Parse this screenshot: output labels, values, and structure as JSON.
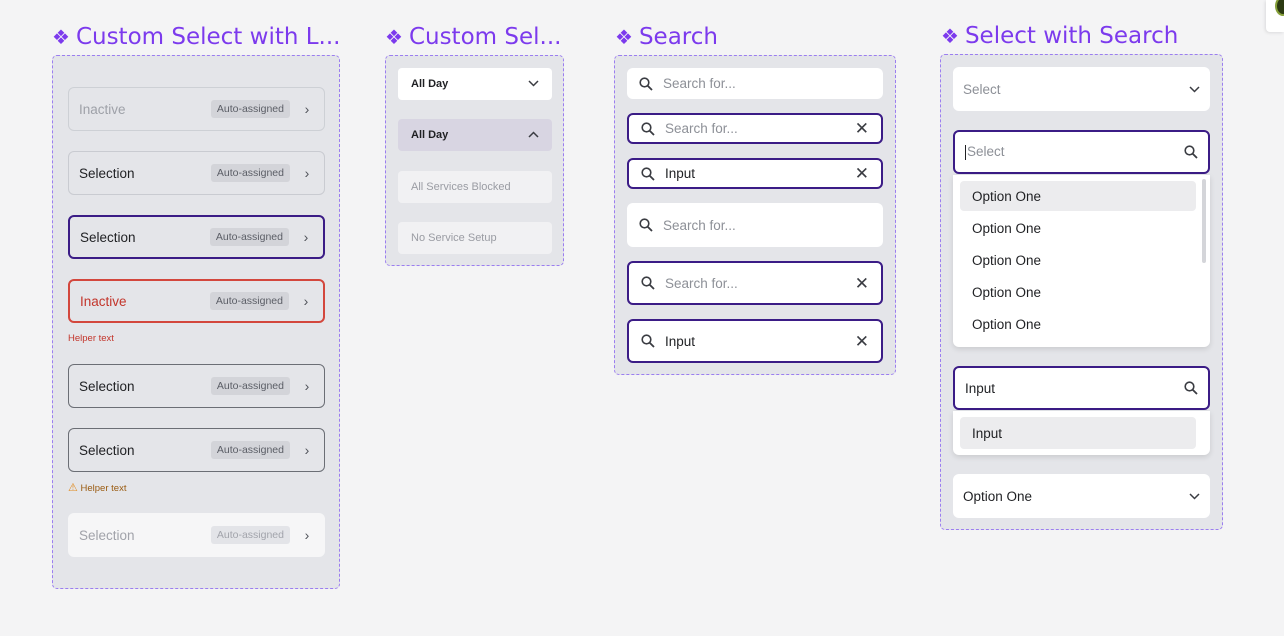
{
  "titles": {
    "custom_select_list": "Custom Select with L...",
    "custom_select": "Custom Sel...",
    "search": "Search",
    "select_with_search": "Select with Search"
  },
  "custom_select_list": {
    "rows": [
      {
        "label": "Inactive",
        "badge": "Auto-assigned",
        "state": "inactive"
      },
      {
        "label": "Selection",
        "badge": "Auto-assigned",
        "state": "default"
      },
      {
        "label": "Selection",
        "badge": "Auto-assigned",
        "state": "active"
      },
      {
        "label": "Inactive",
        "badge": "Auto-assigned",
        "state": "error",
        "helper": "Helper text"
      },
      {
        "label": "Selection",
        "badge": "Auto-assigned",
        "state": "outlined"
      },
      {
        "label": "Selection",
        "badge": "Auto-assigned",
        "state": "warning",
        "helper": "Helper text"
      },
      {
        "label": "Selection",
        "badge": "Auto-assigned",
        "state": "disabled"
      }
    ]
  },
  "custom_select": {
    "items": [
      {
        "label": "All Day",
        "state": "closed"
      },
      {
        "label": "All Day",
        "state": "open"
      },
      {
        "label": "All Services Blocked",
        "state": "disabled"
      },
      {
        "label": "No Service Setup",
        "state": "disabled"
      }
    ]
  },
  "search": {
    "boxes": [
      {
        "placeholder": "Search for...",
        "value": "",
        "state": "default",
        "clear": false
      },
      {
        "placeholder": "Search for...",
        "value": "",
        "state": "focus",
        "clear": true
      },
      {
        "placeholder": "Search for...",
        "value": "Input",
        "state": "focus",
        "clear": true
      },
      {
        "placeholder": "Search for...",
        "value": "",
        "state": "default",
        "clear": false
      },
      {
        "placeholder": "Search for...",
        "value": "",
        "state": "focus",
        "clear": true
      },
      {
        "placeholder": "Search for...",
        "value": "Input",
        "state": "focus",
        "clear": true
      }
    ]
  },
  "select_with_search": {
    "closed_placeholder": "Select",
    "open_placeholder": "Select",
    "options": [
      "Option One",
      "Option One",
      "Option One",
      "Option One",
      "Option One"
    ],
    "filter_value": "Input",
    "filter_results": [
      "Input"
    ],
    "selected_value": "Option One"
  },
  "icons": {
    "diamond": "❖",
    "chevron_right": "›",
    "chevron_down": "⌄",
    "close": "✕",
    "warning": "⚠"
  }
}
